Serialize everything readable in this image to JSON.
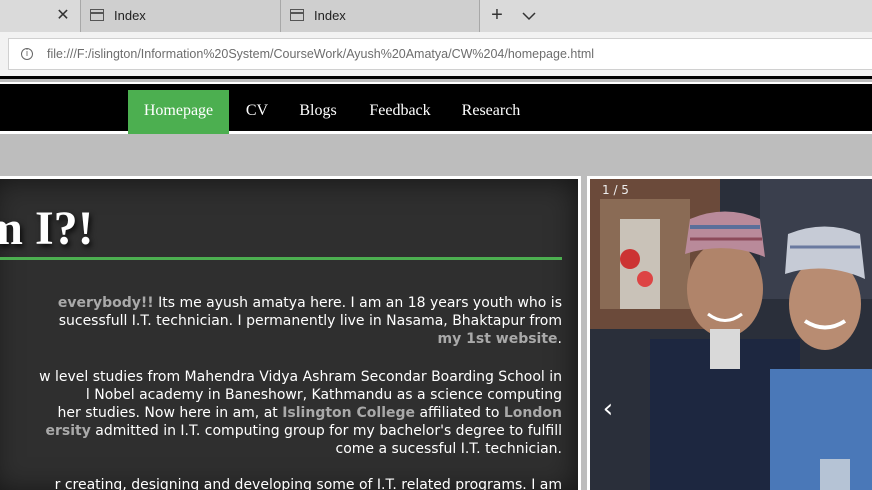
{
  "browser": {
    "tabs": [
      {
        "label": "Index"
      },
      {
        "label": "Index"
      }
    ],
    "address": "file:///F:/islington/Information%20System/CourseWork/Ayush%20Amatya/CW%204/homepage.html"
  },
  "nav": {
    "items": [
      {
        "label": "Homepage",
        "active": true
      },
      {
        "label": "CV"
      },
      {
        "label": "Blogs"
      },
      {
        "label": "Feedback"
      },
      {
        "label": "Research"
      }
    ]
  },
  "main": {
    "heading": "m I?!",
    "p1": {
      "l1_hl": "everybody!!",
      "l1": " Its me ayush amatya here. I am an 18 years youth who is",
      "l2": "sucessfull I.T. technician. I permanently live in Nasama, Bhaktapur from",
      "l3_hl": "my 1st website",
      "l3": "."
    },
    "p2": {
      "l1": "w level studies from Mahendra Vidya Ashram Secondar Boarding School in",
      "l2": "l Nobel academy in Baneshowr, Kathmandu as a science computing",
      "l3a": "her studies. Now here in am, at ",
      "l3_hl1": "Islington College",
      "l3b": " affiliated to ",
      "l3_hl2": "London",
      "l4_hl": "ersity",
      "l4": " admitted in I.T. computing group for my bachelor's degree to fulfill",
      "l5": "come a sucessful I.T. technician."
    },
    "p3": {
      "l1": "r creating, designing and developing some of I.T. related programs. I am"
    }
  },
  "slideshow": {
    "counter": "1 / 5",
    "prev": "‹"
  },
  "colors": {
    "nav_active": "#4caf50",
    "accent_line": "#4caf50",
    "content_bg": "#2f2f2f",
    "page_bg": "#bdbdbd"
  }
}
